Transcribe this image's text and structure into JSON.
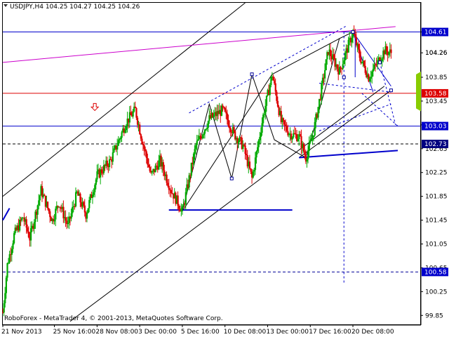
{
  "header": {
    "title": "USDJPY,H4  104.25 104.27 104.25 104.26",
    "arrow_icon": "triangle-down-icon"
  },
  "footer": {
    "copyright": "RoboForex - MetaTrader 4, © 2001-2013, MetaQuotes Software Corp."
  },
  "colors": {
    "bull": "#00aa00",
    "bear": "#dd0000",
    "trend_blue": "#0000cc",
    "magenta": "#cc00cc",
    "level_red": "#dd0000",
    "grid_dash": "#000099",
    "badge_blue": "#0000cc",
    "badge_red": "#dd0000",
    "badge_navy": "#000080",
    "arrow_red": "#dd0000",
    "diag_green": "#88cc00"
  },
  "chart_data": {
    "type": "candlestick",
    "symbol": "USDJPY",
    "timeframe": "H4",
    "ohlc_last": {
      "open": 104.25,
      "high": 104.27,
      "low": 104.25,
      "close": 104.26
    },
    "ylim": [
      99.7,
      105.1
    ],
    "y_ticks": [
      104.61,
      104.26,
      103.85,
      103.45,
      103.05,
      102.65,
      102.25,
      101.85,
      101.45,
      101.05,
      100.65,
      100.25,
      99.85
    ],
    "x_ticks": [
      {
        "label": "21 Nov 2013",
        "t": 0
      },
      {
        "label": "25 Nov 16:00",
        "t": 46
      },
      {
        "label": "28 Nov 08:00",
        "t": 84
      },
      {
        "label": "3 Dec 00:00",
        "t": 122
      },
      {
        "label": "5 Dec 16:00",
        "t": 160
      },
      {
        "label": "10 Dec 08:00",
        "t": 198
      },
      {
        "label": "13 Dec 00:00",
        "t": 236
      },
      {
        "label": "17 Dec 16:00",
        "t": 274
      },
      {
        "label": "20 Dec 08:00",
        "t": 312
      }
    ],
    "x_range": [
      0,
      372
    ],
    "price_badges": [
      {
        "value": 104.61,
        "label": "104.61",
        "style": "blue"
      },
      {
        "value": 104.26,
        "label": "104.26",
        "style": "plain"
      },
      {
        "value": 103.58,
        "label": "103.58",
        "style": "red"
      },
      {
        "value": 103.03,
        "label": "103.03",
        "style": "blue"
      },
      {
        "value": 102.73,
        "label": "102.73",
        "style": "navy"
      },
      {
        "value": 100.58,
        "label": "100.58",
        "style": "blue"
      }
    ],
    "horizontal_levels": [
      {
        "value": 104.61,
        "kind": "blue-solid"
      },
      {
        "value": 103.58,
        "kind": "red-solid"
      },
      {
        "value": 103.03,
        "kind": "blue-solid"
      },
      {
        "value": 102.73,
        "kind": "black-dashed"
      },
      {
        "value": 100.58,
        "kind": "blue-dashed"
      }
    ],
    "waypoints": [
      {
        "t": 0,
        "p": 99.9
      },
      {
        "t": 4,
        "p": 100.7
      },
      {
        "t": 10,
        "p": 101.2
      },
      {
        "t": 18,
        "p": 101.5
      },
      {
        "t": 24,
        "p": 101.15
      },
      {
        "t": 34,
        "p": 101.95
      },
      {
        "t": 44,
        "p": 101.45
      },
      {
        "t": 50,
        "p": 101.75
      },
      {
        "t": 58,
        "p": 101.35
      },
      {
        "t": 66,
        "p": 101.9
      },
      {
        "t": 74,
        "p": 101.55
      },
      {
        "t": 84,
        "p": 102.2
      },
      {
        "t": 96,
        "p": 102.45
      },
      {
        "t": 110,
        "p": 103.1
      },
      {
        "t": 118,
        "p": 103.3
      },
      {
        "t": 124,
        "p": 102.8
      },
      {
        "t": 132,
        "p": 102.2
      },
      {
        "t": 140,
        "p": 102.45
      },
      {
        "t": 150,
        "p": 101.95
      },
      {
        "t": 160,
        "p": 101.6
      },
      {
        "t": 172,
        "p": 102.7
      },
      {
        "t": 184,
        "p": 103.15
      },
      {
        "t": 196,
        "p": 103.3
      },
      {
        "t": 206,
        "p": 102.9
      },
      {
        "t": 214,
        "p": 102.7
      },
      {
        "t": 222,
        "p": 102.15
      },
      {
        "t": 232,
        "p": 103.2
      },
      {
        "t": 240,
        "p": 103.9
      },
      {
        "t": 248,
        "p": 103.1
      },
      {
        "t": 256,
        "p": 102.9
      },
      {
        "t": 264,
        "p": 102.85
      },
      {
        "t": 270,
        "p": 102.5
      },
      {
        "t": 276,
        "p": 102.85
      },
      {
        "t": 282,
        "p": 103.45
      },
      {
        "t": 290,
        "p": 104.3
      },
      {
        "t": 300,
        "p": 103.95
      },
      {
        "t": 312,
        "p": 104.61
      },
      {
        "t": 318,
        "p": 104.2
      },
      {
        "t": 326,
        "p": 103.85
      },
      {
        "t": 334,
        "p": 104.1
      },
      {
        "t": 340,
        "p": 104.3
      },
      {
        "t": 346,
        "p": 104.26
      }
    ],
    "trendlines": [
      {
        "kind": "solid-black",
        "from": {
          "t": 0,
          "p": 101.85
        },
        "to": {
          "t": 216,
          "p": 105.1
        }
      },
      {
        "kind": "solid-black",
        "from": {
          "t": 60,
          "p": 99.75
        },
        "to": {
          "t": 340,
          "p": 103.7
        }
      },
      {
        "kind": "solid-black",
        "from": {
          "t": 160,
          "p": 101.6
        },
        "to": {
          "t": 240,
          "p": 103.9
        }
      },
      {
        "kind": "solid-black",
        "from": {
          "t": 240,
          "p": 103.9
        },
        "to": {
          "t": 300,
          "p": 104.5
        }
      },
      {
        "kind": "solid-black",
        "from": {
          "t": 264,
          "p": 102.5
        },
        "to": {
          "t": 346,
          "p": 103.63
        }
      },
      {
        "kind": "magenta",
        "from": {
          "t": 0,
          "p": 104.1
        },
        "to": {
          "t": 350,
          "p": 104.7
        }
      },
      {
        "kind": "blue-thick",
        "from": {
          "t": 148,
          "p": 101.62
        },
        "to": {
          "t": 258,
          "p": 101.62
        }
      },
      {
        "kind": "blue-thick",
        "from": {
          "t": 264,
          "p": 102.5
        },
        "to": {
          "t": 352,
          "p": 102.62
        }
      },
      {
        "kind": "blue-thick",
        "from": {
          "t": 0,
          "p": 101.45
        },
        "to": {
          "t": 6,
          "p": 101.65
        }
      },
      {
        "kind": "blue-thin",
        "from": {
          "t": 312,
          "p": 104.61
        },
        "to": {
          "t": 330,
          "p": 103.6
        }
      },
      {
        "kind": "blue-thin",
        "from": {
          "t": 312,
          "p": 104.61
        },
        "to": {
          "t": 346,
          "p": 103.7
        }
      },
      {
        "kind": "blue-thin",
        "from": {
          "t": 314,
          "p": 103.85
        },
        "to": {
          "t": 314,
          "p": 104.61
        }
      }
    ],
    "zigzag_wave": [
      {
        "t": 160,
        "p": 101.6
      },
      {
        "t": 184,
        "p": 103.4
      },
      {
        "t": 204,
        "p": 102.15
      },
      {
        "t": 222,
        "p": 103.9
      },
      {
        "t": 242,
        "p": 102.8
      },
      {
        "t": 270,
        "p": 102.5
      },
      {
        "t": 300,
        "p": 104.5
      },
      {
        "t": 312,
        "p": 104.61
      }
    ],
    "dashed_channels": [
      {
        "from": {
          "t": 166,
          "p": 103.25
        },
        "to": {
          "t": 306,
          "p": 104.71
        }
      },
      {
        "from": {
          "t": 282,
          "p": 103.75
        },
        "to": {
          "t": 346,
          "p": 103.6
        }
      },
      {
        "from": {
          "t": 282,
          "p": 102.95
        },
        "to": {
          "t": 346,
          "p": 103.4
        }
      },
      {
        "from": {
          "t": 336,
          "p": 104.1
        },
        "to": {
          "t": 350,
          "p": 103.05
        }
      },
      {
        "from": {
          "t": 320,
          "p": 103.58
        },
        "to": {
          "t": 352,
          "p": 103.03
        }
      }
    ],
    "vertical_marker": {
      "t": 304,
      "from": 104.61,
      "to": 100.4
    },
    "anchor_points": [
      {
        "t": 204,
        "p": 102.15
      },
      {
        "t": 222,
        "p": 103.9
      },
      {
        "t": 304,
        "p": 103.85
      },
      {
        "t": 312,
        "p": 104.61
      },
      {
        "t": 336,
        "p": 104.1
      },
      {
        "t": 346,
        "p": 103.63
      }
    ],
    "signal_arrow": {
      "t": 82,
      "p": 103.35,
      "direction": "down"
    }
  }
}
